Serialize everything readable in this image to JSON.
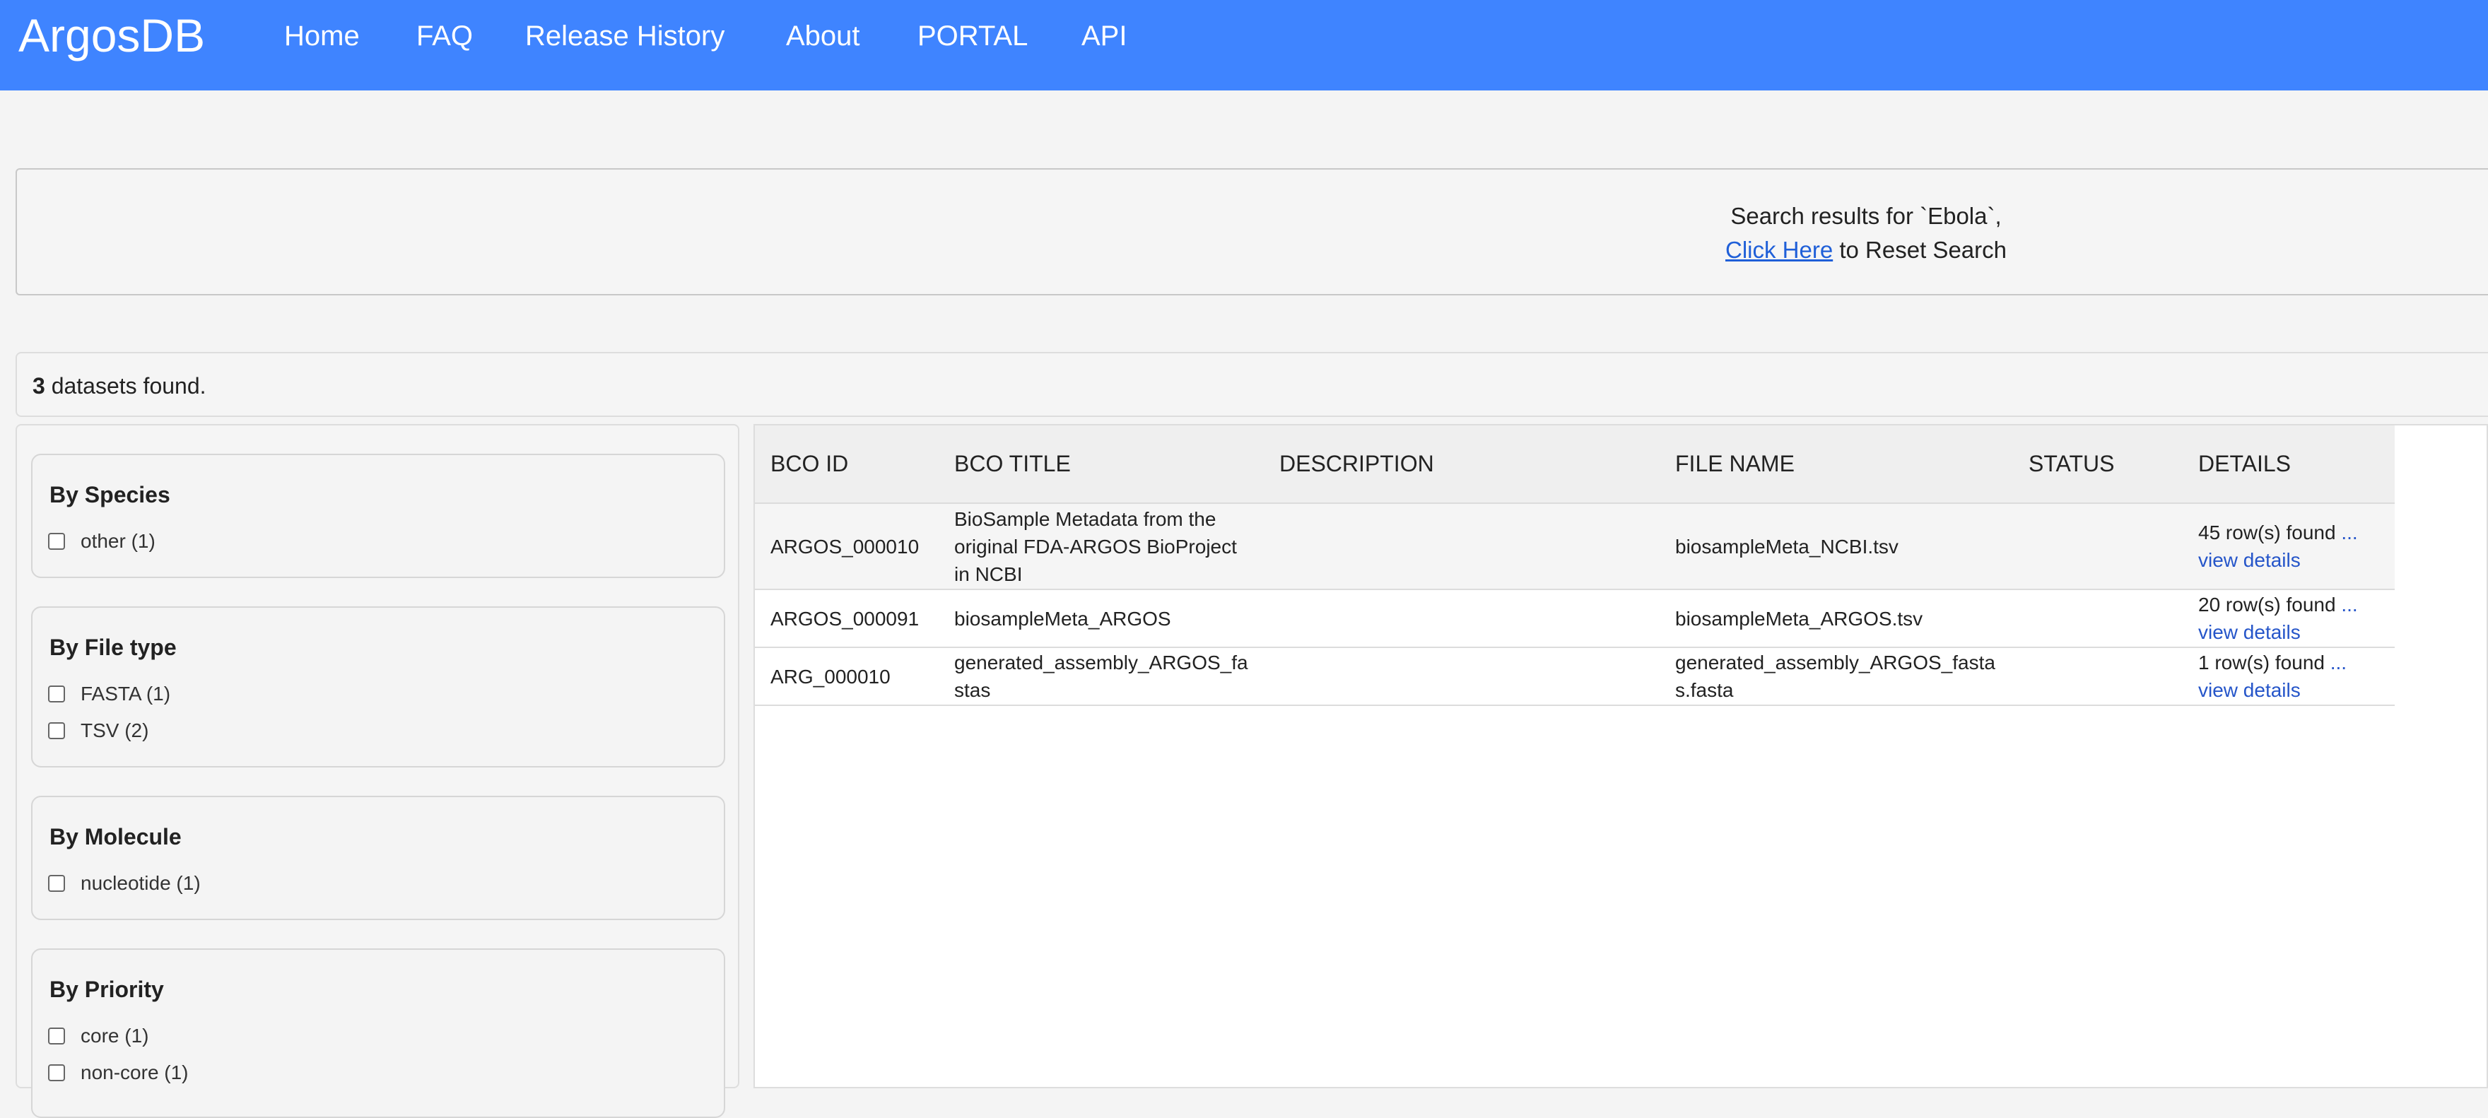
{
  "navbar": {
    "brand": "ArgosDB",
    "links": [
      "Home",
      "FAQ",
      "Release History",
      "About",
      "PORTAL",
      "API"
    ]
  },
  "search": {
    "results_text": "Search results for `Ebola`,",
    "reset_link": "Click Here",
    "reset_suffix": " to Reset Search"
  },
  "summary": {
    "count": "3",
    "suffix": " datasets found."
  },
  "facets": [
    {
      "title": "By Species",
      "options": [
        "other (1)"
      ]
    },
    {
      "title": "By File type",
      "options": [
        "FASTA (1)",
        "TSV (2)"
      ]
    },
    {
      "title": "By Molecule",
      "options": [
        "nucleotide (1)"
      ]
    },
    {
      "title": "By Priority",
      "options": [
        "core (1)",
        "non-core (1)"
      ]
    }
  ],
  "table": {
    "headers": [
      "BCO ID",
      "BCO TITLE",
      "DESCRIPTION",
      "FILE NAME",
      "STATUS",
      "DETAILS"
    ],
    "rows": [
      {
        "bco_id": "ARGOS_000010",
        "title": "BioSample Metadata from the original FDA-ARGOS BioProject in NCBI",
        "description": "",
        "file_name": "biosampleMeta_NCBI.tsv",
        "status": "",
        "details_count": "45 row(s) found ",
        "details_dots": "...",
        "details_link": "view details"
      },
      {
        "bco_id": "ARGOS_000091",
        "title": "biosampleMeta_ARGOS",
        "description": "",
        "file_name": "biosampleMeta_ARGOS.tsv",
        "status": "",
        "details_count": "20 row(s) found ",
        "details_dots": "...",
        "details_link": "view details"
      },
      {
        "bco_id": "ARG_000010",
        "title": "generated_assembly_ARGOS_fastas",
        "description": "",
        "file_name": "generated_assembly_ARGOS_fastas.fasta",
        "status": "",
        "details_count": "1 row(s) found ",
        "details_dots": "...",
        "details_link": "view details"
      }
    ]
  },
  "colors": {
    "navbar": "#3f84ff",
    "link": "#2555c9",
    "background": "#f4f4f4"
  }
}
